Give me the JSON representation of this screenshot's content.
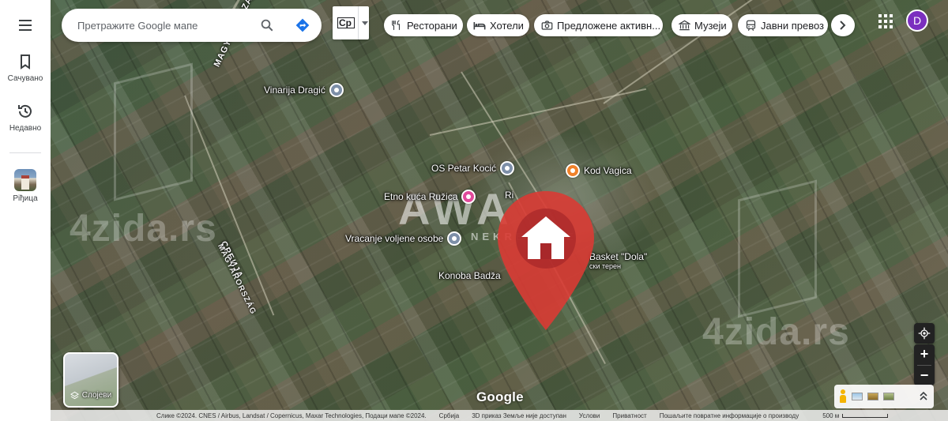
{
  "rail": {
    "menu_icon": "hamburger-menu-icon",
    "saved_label": "Сачувано",
    "recent_label": "Недавно",
    "recent_place_label": "Рiђица"
  },
  "search": {
    "placeholder": "Претражите Google мапе",
    "search_icon": "search-icon",
    "directions_icon": "directions-icon"
  },
  "language": {
    "code": "Ср"
  },
  "chips": [
    {
      "label": "Ресторани",
      "icon": "fork-knife-icon"
    },
    {
      "label": "Хотели",
      "icon": "bed-icon"
    },
    {
      "label": "Предложене активн...",
      "icon": "camera-icon"
    },
    {
      "label": "Музеји",
      "icon": "museum-icon"
    },
    {
      "label": "Јавни превоз",
      "icon": "transit-icon"
    }
  ],
  "account": {
    "initial": "D",
    "color": "#7b2fbf"
  },
  "map": {
    "watermark_left": "4zida.rs",
    "watermark_right": "4zida.rs",
    "agency_text": "AWA",
    "agency_sub": "NEKRETNINE",
    "road_label_1": "MAGYARORSZAG",
    "road_label_2": "СРБИЈА",
    "road_label_3": "MAGYARORSZÁG",
    "places": {
      "vinarija": "Vinarija Dragić",
      "os_petar": "OS Petar Kocić",
      "kod_vagica": "Kod Vagica",
      "etno_kuca": "Etno kuća Ružica",
      "ri_label": "Ri",
      "vracanje": "Vracanje voljene osobe",
      "basket": "Basket \"Dola\"",
      "basket_sub": "ски терен",
      "konoba": "Konoba Badža"
    },
    "marker_color": "#d93b34"
  },
  "layers": {
    "label": "Слојеви"
  },
  "logo": "Google",
  "attribution": {
    "imagery": "Слике ©2024. CNES / Airbus, Landsat / Copernicus, Maxar Technologies, Подаци мапе ©2024.",
    "country": "Србија",
    "earth": "3D приказ Земље није доступан",
    "terms": "Услови",
    "privacy": "Приватност",
    "feedback": "Пошаљите повратне информације о производу",
    "scale": "500 м"
  }
}
